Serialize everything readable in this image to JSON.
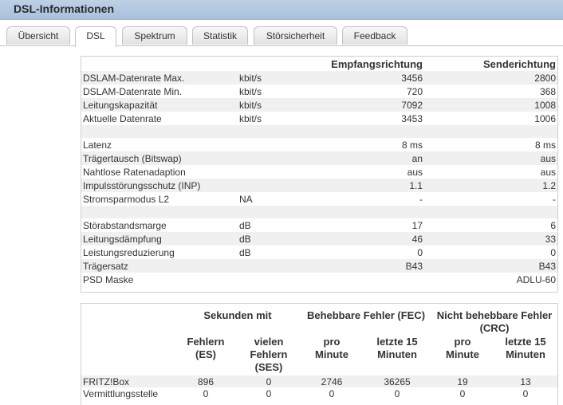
{
  "title": "DSL-Informationen",
  "tabs": [
    {
      "label": "Übersicht",
      "active": false
    },
    {
      "label": "DSL",
      "active": true
    },
    {
      "label": "Spektrum",
      "active": false
    },
    {
      "label": "Statistik",
      "active": false
    },
    {
      "label": "Störsicherheit",
      "active": false
    },
    {
      "label": "Feedback",
      "active": false
    }
  ],
  "dsl_table": {
    "headers": {
      "rx": "Empfangsrichtung",
      "tx": "Senderichtung"
    },
    "rows": [
      {
        "label": "DSLAM-Datenrate Max.",
        "unit": "kbit/s",
        "rx": "3456",
        "tx": "2800"
      },
      {
        "label": "DSLAM-Datenrate Min.",
        "unit": "kbit/s",
        "rx": "720",
        "tx": "368"
      },
      {
        "label": "Leitungskapazität",
        "unit": "kbit/s",
        "rx": "7092",
        "tx": "1008"
      },
      {
        "label": "Aktuelle Datenrate",
        "unit": "kbit/s",
        "rx": "3453",
        "tx": "1006"
      },
      {
        "label": "Latenz",
        "unit": "",
        "rx": "8 ms",
        "tx": "8 ms"
      },
      {
        "label": "Trägertausch (Bitswap)",
        "unit": "",
        "rx": "an",
        "tx": "aus"
      },
      {
        "label": "Nahtlose Ratenadaption",
        "unit": "",
        "rx": "aus",
        "tx": "aus"
      },
      {
        "label": "Impulsstörungsschutz (INP)",
        "unit": "",
        "rx": "1.1",
        "tx": "1.2"
      },
      {
        "label": "Stromsparmodus L2",
        "unit": "NA",
        "rx": "-",
        "tx": "-"
      },
      {
        "label": "Störabstandsmarge",
        "unit": "dB",
        "rx": "17",
        "tx": "6"
      },
      {
        "label": "Leitungsdämpfung",
        "unit": "dB",
        "rx": "46",
        "tx": "33"
      },
      {
        "label": "Leistungsreduzierung",
        "unit": "dB",
        "rx": "0",
        "tx": "0"
      },
      {
        "label": "Trägersatz",
        "unit": "",
        "rx": "B43",
        "tx": "B43"
      },
      {
        "label": "PSD Maske",
        "unit": "",
        "rx": "",
        "tx": "ADLU-60"
      }
    ]
  },
  "error_table": {
    "group_headers": {
      "seconds": "Sekunden mit",
      "fec": "Behebbare Fehler (FEC)",
      "crc": "Nicht behebbare Fehler (CRC)"
    },
    "sub_headers": {
      "es": "Fehlern (ES)",
      "ses": "vielen Fehlern (SES)",
      "fec_min": "pro Minute",
      "fec_15": "letzte 15 Minuten",
      "crc_min": "pro Minute",
      "crc_15": "letzte 15 Minuten"
    },
    "rows": [
      {
        "label": "FRITZ!Box",
        "es": "896",
        "ses": "0",
        "fec_min": "2746",
        "fec_15": "36265",
        "crc_min": "19",
        "crc_15": "13"
      },
      {
        "label": "Vermittlungsstelle",
        "es": "0",
        "ses": "0",
        "fec_min": "0",
        "fec_15": "0",
        "crc_min": "0",
        "crc_15": "0"
      }
    ]
  }
}
